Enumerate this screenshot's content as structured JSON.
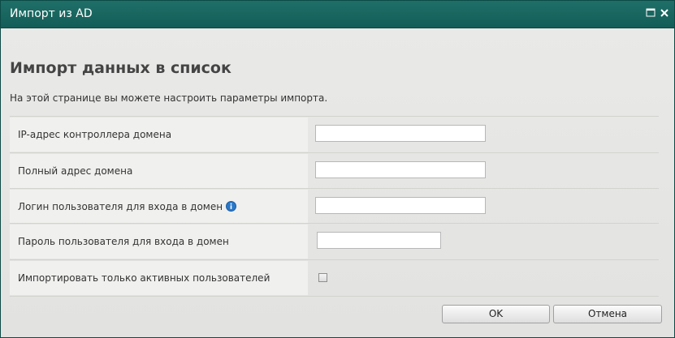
{
  "window": {
    "title": "Импорт из AD"
  },
  "page": {
    "heading": "Импорт данных в список",
    "description": "На этой странице вы можете настроить параметры импорта."
  },
  "form": {
    "fields": [
      {
        "label": "IP-адрес контроллера домена",
        "value": ""
      },
      {
        "label": "Полный адрес домена",
        "value": ""
      },
      {
        "label": "Логин пользователя для входа в домен",
        "value": ""
      },
      {
        "label": "Пароль пользователя для входа в домен",
        "value": ""
      }
    ],
    "active_only": {
      "label": "Импортировать только активных пользователей",
      "checked": false
    }
  },
  "buttons": {
    "ok": "OK",
    "cancel": "Отмена"
  },
  "icons": {
    "maximize": "maximize-icon",
    "close": "close-icon",
    "info": "info-icon"
  },
  "colors": {
    "titlebar": "#135d57",
    "title_text": "#ffffff",
    "heading_text": "#444444",
    "label_cell": "#f0f0ee",
    "info_icon": "#2a78c8"
  }
}
